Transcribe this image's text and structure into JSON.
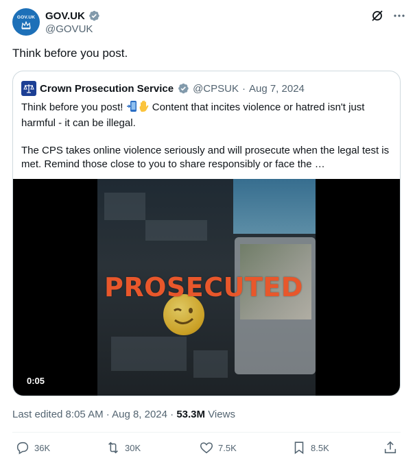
{
  "author": {
    "avatar_text": "GOV.UK",
    "display_name": "GOV.UK",
    "handle": "@GOVUK"
  },
  "tweet": {
    "text": "Think before you post."
  },
  "quote": {
    "display_name": "Crown Prosecution Service",
    "handle": "@CPSUK",
    "separator": "·",
    "date": "Aug 7, 2024",
    "body_1": "Think before you post! ",
    "body_1b": " Content that incites violence or hatred isn't just harmful - it can be illegal.",
    "body_2": "The CPS takes online violence seriously and will prosecute when the legal test is met. Remind those close to you to share responsibly or face the …",
    "video_overlay_text": "PROSECUTED",
    "video_duration": "0:05"
  },
  "meta": {
    "edited_label": "Last edited 8:05 AM · Aug 8, 2024 · ",
    "views_count": "53.3M",
    "views_label": " Views"
  },
  "actions": {
    "replies": "36K",
    "reposts": "30K",
    "likes": "7.5K",
    "bookmarks": "8.5K"
  },
  "colors": {
    "verified_badge": "#829aab",
    "govuk_blue": "#1d70b8",
    "cps_blue": "#1c3f94",
    "overlay_text": "#e8572b"
  },
  "icons": [
    "grok-icon",
    "more-icon",
    "verified-badge-icon",
    "reply-icon",
    "repost-icon",
    "like-icon",
    "bookmark-icon",
    "share-icon"
  ]
}
